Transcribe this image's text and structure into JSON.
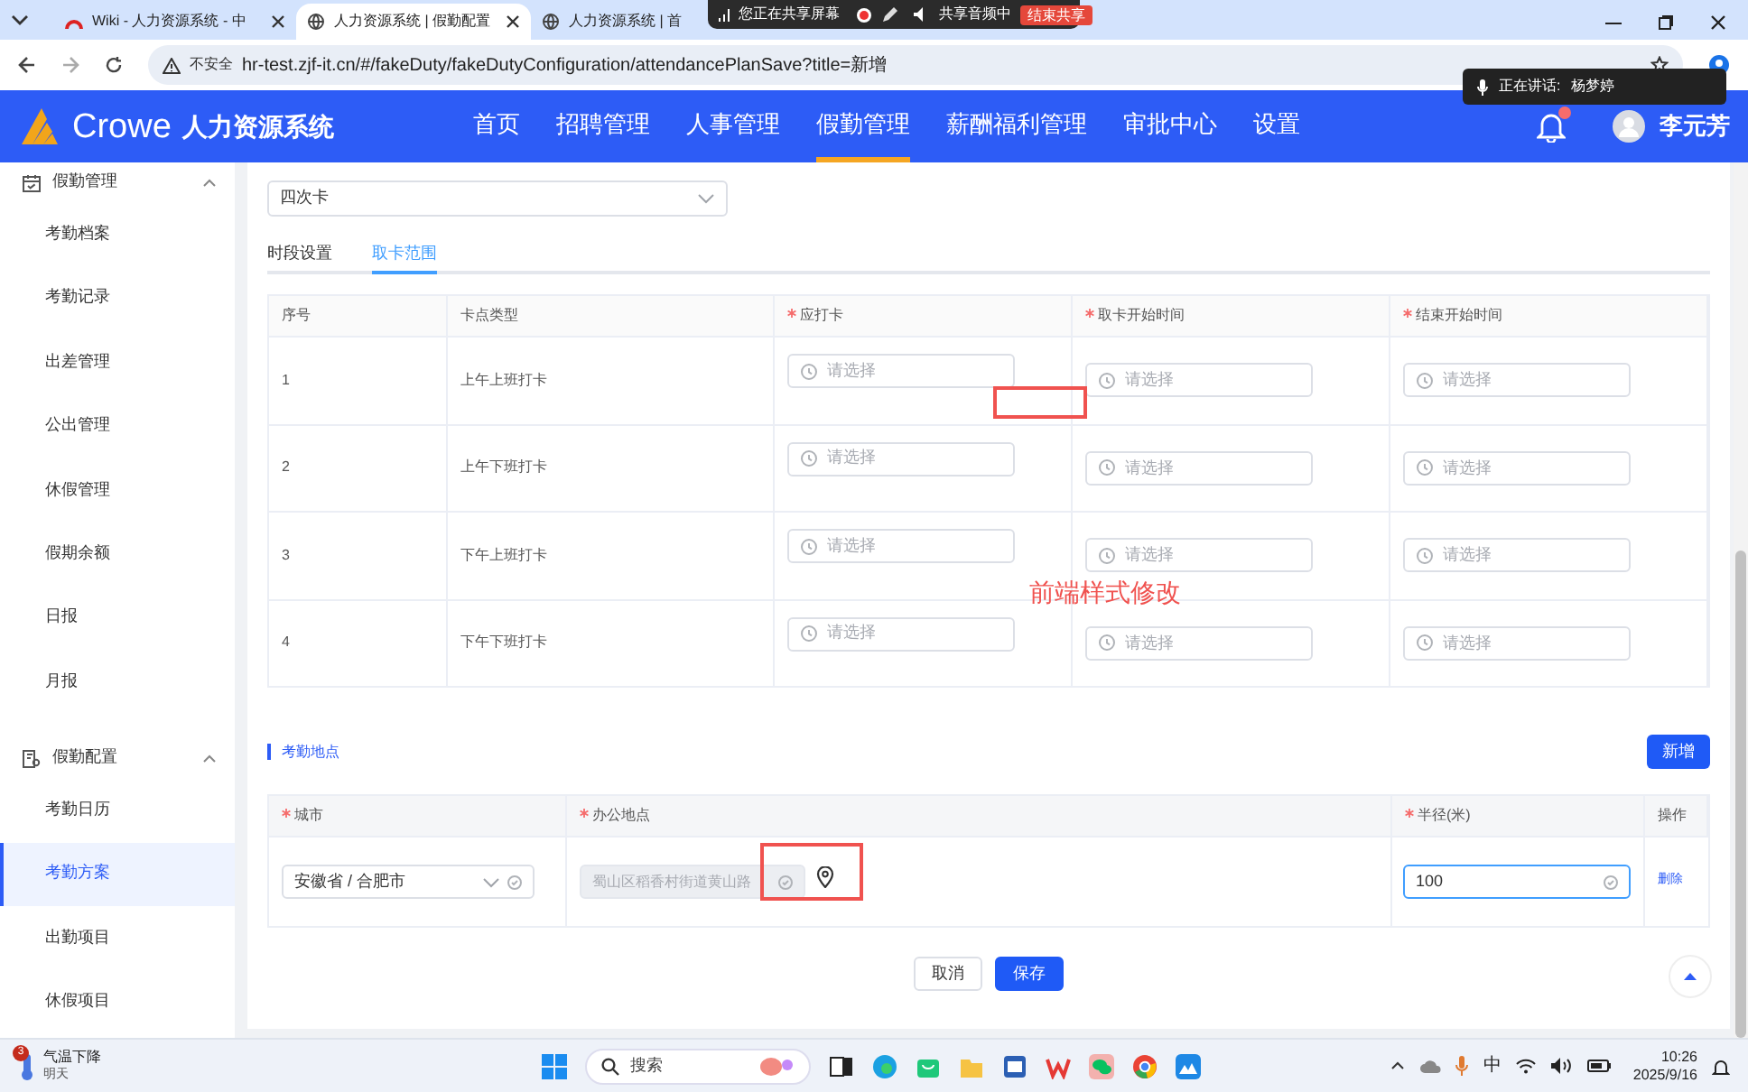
{
  "browser": {
    "tabs": [
      {
        "title": "Wiki - 人力资源系统 - 中",
        "selected": false
      },
      {
        "title": "人力资源系统 | 假勤配置",
        "selected": true
      },
      {
        "title": "人力资源系统 | 首",
        "selected": false
      }
    ],
    "share_bar": {
      "status": "您正在共享屏幕",
      "audio": "共享音频中",
      "stop_button": "结束共享"
    },
    "address_bar": {
      "security": "不安全",
      "url": "hr-test.zjf-it.cn/#/fakeDuty/fakeDutyConfiguration/attendancePlanSave?title=新增"
    },
    "speaking": {
      "label": "正在讲话:",
      "name": "杨梦婷"
    }
  },
  "app": {
    "brand": "Crowe",
    "system_name": "人力资源系统",
    "nav": [
      {
        "label": "首页",
        "selected": false
      },
      {
        "label": "招聘管理",
        "selected": false
      },
      {
        "label": "人事管理",
        "selected": false
      },
      {
        "label": "假勤管理",
        "selected": true
      },
      {
        "label": "薪酬福利管理",
        "selected": false
      },
      {
        "label": "审批中心",
        "selected": false
      },
      {
        "label": "设置",
        "selected": false
      }
    ],
    "user": "李元芳"
  },
  "sidebar": [
    {
      "label": "假勤管理",
      "expanded": true,
      "children": [
        {
          "label": "考勤档案",
          "selected": false
        },
        {
          "label": "考勤记录",
          "selected": false
        },
        {
          "label": "出差管理",
          "selected": false
        },
        {
          "label": "公出管理",
          "selected": false
        },
        {
          "label": "休假管理",
          "selected": false
        },
        {
          "label": "假期余额",
          "selected": false
        },
        {
          "label": "日报",
          "selected": false
        },
        {
          "label": "月报",
          "selected": false
        }
      ]
    },
    {
      "label": "假勤配置",
      "expanded": true,
      "children": [
        {
          "label": "考勤日历",
          "selected": false
        },
        {
          "label": "考勤方案",
          "selected": true
        },
        {
          "label": "出勤项目",
          "selected": false
        },
        {
          "label": "休假项目",
          "selected": false
        }
      ]
    }
  ],
  "form": {
    "mode_value": "四次卡",
    "tabs": [
      {
        "label": "时段设置",
        "selected": false
      },
      {
        "label": "取卡范围",
        "selected": true
      }
    ],
    "punch_table": {
      "columns": [
        {
          "label": "序号",
          "required": false
        },
        {
          "label": "卡点类型",
          "required": false
        },
        {
          "label": "应打卡",
          "required": true
        },
        {
          "label": "取卡开始时间",
          "required": true
        },
        {
          "label": "结束开始时间",
          "required": true
        }
      ],
      "rows": [
        {
          "index": "1",
          "type": "上午上班打卡",
          "fields": [
            {
              "placeholder": "请选择"
            },
            {
              "placeholder": "请选择"
            },
            {
              "placeholder": "请选择"
            }
          ]
        },
        {
          "index": "2",
          "type": "上午下班打卡",
          "fields": [
            {
              "placeholder": "请选择"
            },
            {
              "placeholder": "请选择"
            },
            {
              "placeholder": "请选择"
            }
          ]
        },
        {
          "index": "3",
          "type": "下午上班打卡",
          "fields": [
            {
              "placeholder": "请选择"
            },
            {
              "placeholder": "请选择"
            },
            {
              "placeholder": "请选择"
            }
          ]
        },
        {
          "index": "4",
          "type": "下午下班打卡",
          "fields": [
            {
              "placeholder": "请选择"
            },
            {
              "placeholder": "请选择"
            },
            {
              "placeholder": "请选择"
            }
          ]
        }
      ]
    },
    "location": {
      "title": "考勤地点",
      "add_button": "新增",
      "columns": [
        {
          "label": "城市",
          "required": true
        },
        {
          "label": "办公地点",
          "required": true
        },
        {
          "label": "半径(米)",
          "required": true
        },
        {
          "label": "操作",
          "required": false
        }
      ],
      "rows": [
        {
          "city": "安徽省 / 合肥市",
          "office": "蜀山区稻香村街道黄山路",
          "office_disabled": true,
          "radius": "100",
          "radius_focused": true,
          "action": "删除"
        }
      ]
    },
    "buttons": [
      {
        "label": "取消",
        "kind": "default"
      },
      {
        "label": "保存",
        "kind": "primary"
      }
    ]
  },
  "annotation": {
    "text": "前端样式修改"
  },
  "taskbar": {
    "weather": {
      "badge": "3",
      "title": "气温下降",
      "subtitle": "明天"
    },
    "search": "搜索",
    "ime": "中",
    "time": "10:26",
    "date": "2025/9/16"
  }
}
